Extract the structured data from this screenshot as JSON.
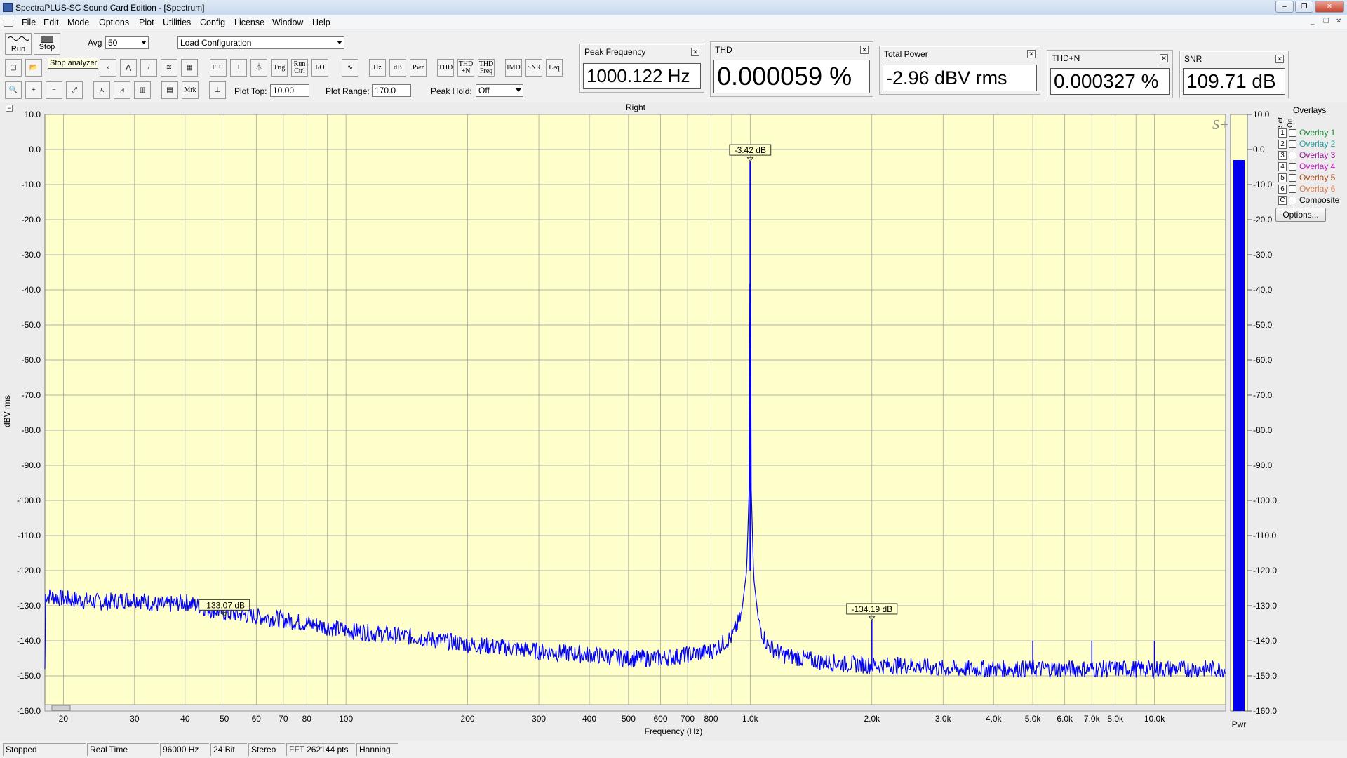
{
  "window": {
    "title": "SpectraPLUS-SC Sound Card Edition - [Spectrum]"
  },
  "menu": [
    "File",
    "Edit",
    "Mode",
    "Options",
    "Plot",
    "Utilities",
    "Config",
    "License",
    "Window",
    "Help"
  ],
  "toolbar": {
    "run_label": "Run",
    "stop_label": "Stop",
    "tooltip": "Stop analyzer",
    "avg_label": "Avg",
    "avg_value": "50",
    "config_value": "Load Configuration",
    "buttons": [
      "FFT",
      "Trig",
      "Run Ctrl",
      "I/O",
      "Hz",
      "dB",
      "Pwr",
      "THD",
      "THD +N",
      "THD Freq",
      "IMD",
      "SNR",
      "Leq"
    ],
    "row2_buttons": [
      "Mrk"
    ],
    "plot_top_label": "Plot Top:",
    "plot_top_value": "10.00",
    "plot_range_label": "Plot Range:",
    "plot_range_value": "170.0",
    "peak_hold_label": "Peak Hold:",
    "peak_hold_value": "Off"
  },
  "meters": [
    {
      "title": "Peak Frequency",
      "value": "1000.122 Hz"
    },
    {
      "title": "THD",
      "value": "0.000059 %"
    },
    {
      "title": "Total Power",
      "value": "-2.96 dBV rms"
    },
    {
      "title": "THD+N",
      "value": "0.000327 %"
    },
    {
      "title": "SNR",
      "value": "109.71 dB"
    }
  ],
  "plot": {
    "channel_title": "Right",
    "ylabel": "dBV rms",
    "xlabel": "Frequency (Hz)",
    "pwr_label": "Pwr",
    "logo": "S+",
    "markers": [
      {
        "label": "-3.42 dB",
        "freq": 1000,
        "db": -3.42
      },
      {
        "label": "-133.07 dB",
        "freq": 50,
        "db": -133.07
      },
      {
        "label": "-134.19 dB",
        "freq": 2000,
        "db": -134.19
      }
    ],
    "pwr_level_db": -3.0
  },
  "chart_data": {
    "type": "line",
    "title": "Right",
    "xlabel": "Frequency (Hz)",
    "ylabel": "dBV rms",
    "xscale": "log",
    "xlim": [
      18,
      15000
    ],
    "ylim": [
      -160,
      10
    ],
    "yticks": [
      "10.0",
      "0.0",
      "-10.0",
      "-20.0",
      "-30.0",
      "-40.0",
      "-50.0",
      "-60.0",
      "-70.0",
      "-80.0",
      "-90.0",
      "-100.0",
      "-110.0",
      "-120.0",
      "-130.0",
      "-140.0",
      "-150.0",
      "-160.0"
    ],
    "xticks": [
      "20",
      "30",
      "40",
      "50",
      "60",
      "70",
      "80",
      "100",
      "200",
      "300",
      "400",
      "500",
      "600",
      "700",
      "800",
      "1.0k",
      "2.0k",
      "3.0k",
      "4.0k",
      "5.0k",
      "6.0k",
      "7.0k",
      "8.0k",
      "10.0k"
    ],
    "grid": true,
    "series": [
      {
        "color": "#0000ff",
        "x": [
          18,
          20,
          25,
          30,
          35,
          40,
          50,
          60,
          70,
          80,
          100,
          120,
          150,
          200,
          250,
          300,
          400,
          500,
          600,
          700,
          800,
          900,
          950,
          980,
          995,
          1000,
          1005,
          1020,
          1050,
          1100,
          1200,
          1500,
          2000,
          2500,
          3000,
          4000,
          5000,
          6000,
          7000,
          8000,
          10000,
          12000,
          15000
        ],
        "y": [
          -127,
          -128,
          -129,
          -128,
          -130,
          -129,
          -132,
          -133,
          -134,
          -135,
          -137,
          -138,
          -139,
          -141,
          -142,
          -143,
          -144,
          -145,
          -145,
          -144,
          -143,
          -139,
          -133,
          -120,
          -95,
          -3.42,
          -95,
          -122,
          -135,
          -141,
          -144,
          -146,
          -147,
          -147,
          -148,
          -148,
          -148,
          -148,
          -148,
          -148,
          -148,
          -148,
          -148
        ]
      }
    ],
    "spikes": [
      {
        "x": 2000,
        "y": -134.19
      },
      {
        "x": 5000,
        "y": -140
      },
      {
        "x": 7000,
        "y": -140
      },
      {
        "x": 10000,
        "y": -140
      }
    ]
  },
  "overlays": {
    "title": "Overlays",
    "col_set": "Set",
    "col_on": "On",
    "items": [
      {
        "num": "1",
        "label": "Overlay 1",
        "color": "#1e8c3a"
      },
      {
        "num": "2",
        "label": "Overlay 2",
        "color": "#17a3a3"
      },
      {
        "num": "3",
        "label": "Overlay 3",
        "color": "#9a1a9a"
      },
      {
        "num": "4",
        "label": "Overlay 4",
        "color": "#d01ad0"
      },
      {
        "num": "5",
        "label": "Overlay 5",
        "color": "#b04a1a"
      },
      {
        "num": "6",
        "label": "Overlay 6",
        "color": "#e07a4a"
      },
      {
        "num": "C",
        "label": "Composite",
        "color": "#000000"
      }
    ],
    "options_label": "Options..."
  },
  "status": [
    "Stopped",
    "Real Time",
    "96000 Hz",
    "24 Bit",
    "Stereo",
    "FFT 262144 pts",
    "Hanning"
  ]
}
